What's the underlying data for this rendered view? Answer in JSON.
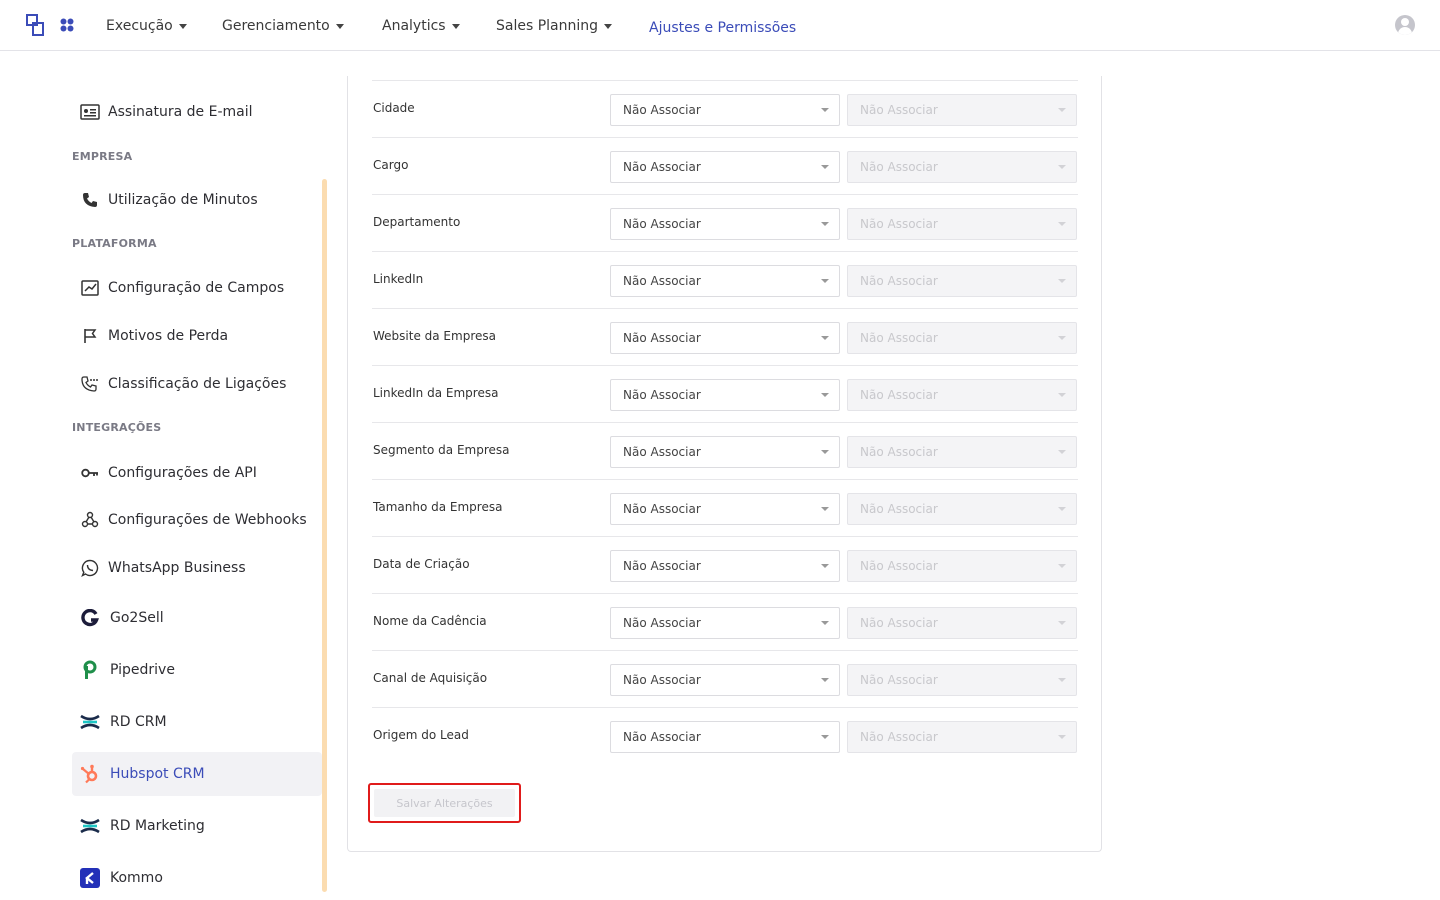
{
  "nav": {
    "items": [
      {
        "label": "Execução"
      },
      {
        "label": "Gerenciamento"
      },
      {
        "label": "Analytics"
      },
      {
        "label": "Sales Planning"
      },
      {
        "label": "Ajustes e Permissões"
      }
    ]
  },
  "sidebar": {
    "email_signature": "Assinatura de E-mail",
    "section_empresa": "EMPRESA",
    "minutes_usage": "Utilização de Minutos",
    "section_plataforma": "PLATAFORMA",
    "field_config": "Configuração de Campos",
    "loss_reasons": "Motivos de Perda",
    "call_classification": "Classificação de Ligações",
    "section_integracoes": "INTEGRAÇÕES",
    "api_settings": "Configurações de API",
    "webhook_settings": "Configurações de Webhooks",
    "whatsapp": "WhatsApp Business",
    "go2sell": "Go2Sell",
    "pipedrive": "Pipedrive",
    "rd_crm": "RD CRM",
    "hubspot": "Hubspot CRM",
    "rd_marketing": "RD Marketing",
    "kommo": "Kommo"
  },
  "mapping": {
    "rows": [
      {
        "label": "Cidade",
        "value": "Não Associar",
        "secondary": "Não Associar"
      },
      {
        "label": "Cargo",
        "value": "Não Associar",
        "secondary": "Não Associar"
      },
      {
        "label": "Departamento",
        "value": "Não Associar",
        "secondary": "Não Associar"
      },
      {
        "label": "LinkedIn",
        "value": "Não Associar",
        "secondary": "Não Associar"
      },
      {
        "label": "Website da Empresa",
        "value": "Não Associar",
        "secondary": "Não Associar"
      },
      {
        "label": "LinkedIn da Empresa",
        "value": "Não Associar",
        "secondary": "Não Associar"
      },
      {
        "label": "Segmento da Empresa",
        "value": "Não Associar",
        "secondary": "Não Associar"
      },
      {
        "label": "Tamanho da Empresa",
        "value": "Não Associar",
        "secondary": "Não Associar"
      },
      {
        "label": "Data de Criação",
        "value": "Não Associar",
        "secondary": "Não Associar"
      },
      {
        "label": "Nome da Cadência",
        "value": "Não Associar",
        "secondary": "Não Associar"
      },
      {
        "label": "Canal de Aquisição",
        "value": "Não Associar",
        "secondary": "Não Associar"
      },
      {
        "label": "Origem do Lead",
        "value": "Não Associar",
        "secondary": "Não Associar"
      }
    ],
    "save_label": "Salvar Alterações"
  },
  "colors": {
    "accent": "#3b4cb8",
    "highlight_border": "#e01b1b",
    "scroll_track": "#fbdcb0",
    "hubspot": "#ff7a59"
  }
}
